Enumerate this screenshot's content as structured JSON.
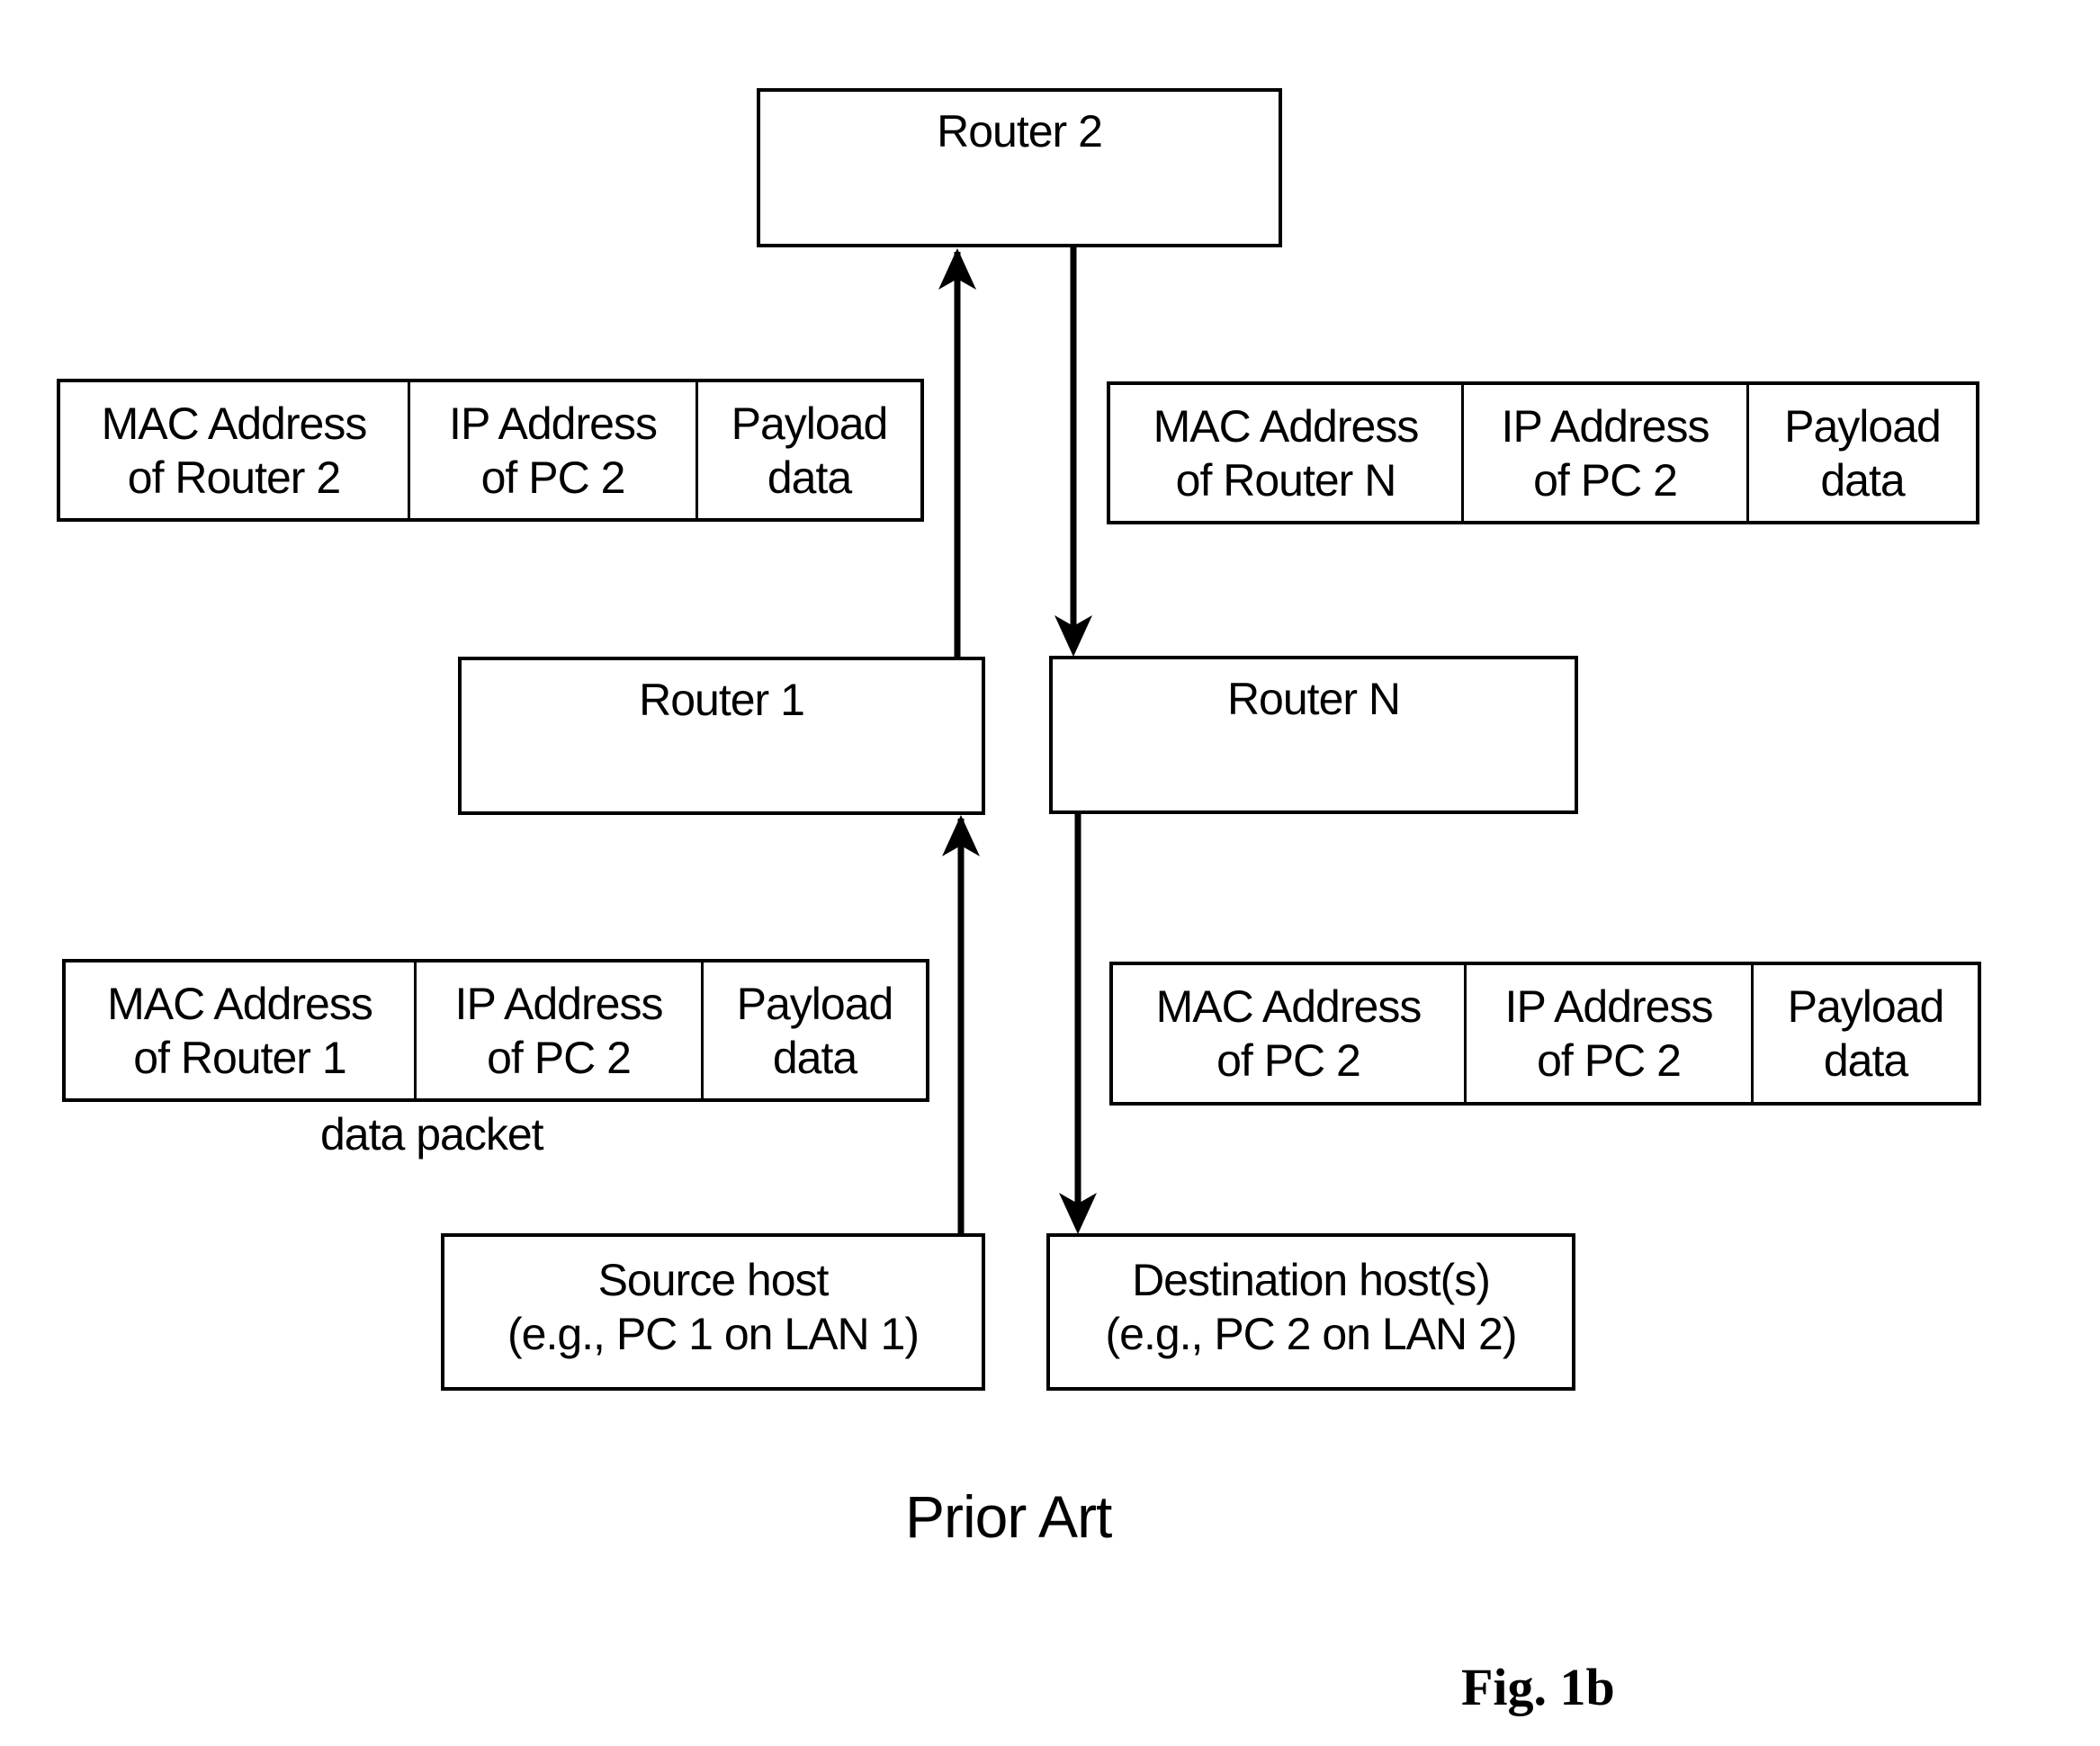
{
  "nodes": {
    "router2": "Router 2",
    "router1": "Router 1",
    "routerN": "Router N",
    "source_host": "Source host\n(e.g., PC 1 on LAN 1)",
    "destination_host": "Destination host(s)\n(e.g., PC 2 on LAN 2)"
  },
  "packets": {
    "router1_to_router2": [
      "MAC Address\nof Router 2",
      "IP Address\nof PC 2",
      "Payload\ndata"
    ],
    "router2_to_routerN": [
      "MAC Address\nof Router N",
      "IP Address\nof PC 2",
      "Payload\ndata"
    ],
    "source_to_router1": [
      "MAC Address\nof Router 1",
      "IP Address\nof PC 2",
      "Payload\ndata"
    ],
    "routerN_to_destination": [
      "MAC Address\nof PC 2",
      "IP Address\nof PC 2",
      "Payload\ndata"
    ]
  },
  "labels": {
    "data_packet": "data packet",
    "prior_art": "Prior Art",
    "figure": "Fig. 1b"
  },
  "edges": [
    {
      "from": "source_host",
      "to": "router1",
      "direction": "up"
    },
    {
      "from": "router1",
      "to": "router2",
      "direction": "up"
    },
    {
      "from": "router2",
      "to": "routerN",
      "direction": "down"
    },
    {
      "from": "routerN",
      "to": "destination_host",
      "direction": "down"
    }
  ]
}
